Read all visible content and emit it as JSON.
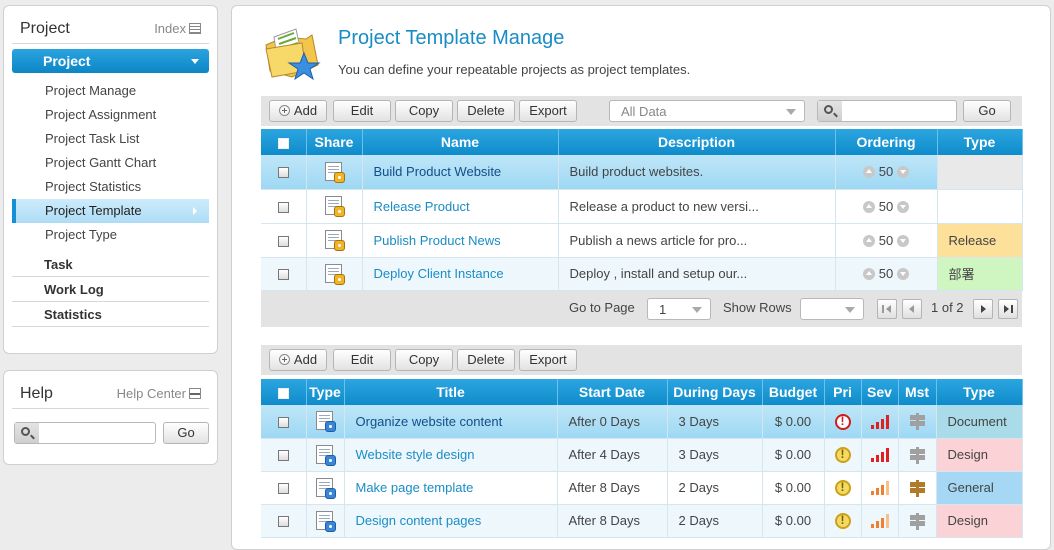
{
  "sidebar": {
    "title": "Project",
    "index_link": "Index",
    "group_label": "Project",
    "items": [
      {
        "label": "Project Manage"
      },
      {
        "label": "Project Assignment"
      },
      {
        "label": "Project Task List"
      },
      {
        "label": "Project Gantt Chart"
      },
      {
        "label": "Project Statistics"
      },
      {
        "label": "Project Template",
        "active": true
      },
      {
        "label": "Project Type"
      }
    ],
    "groups": [
      {
        "label": "Task"
      },
      {
        "label": "Work Log"
      },
      {
        "label": "Statistics"
      }
    ]
  },
  "help": {
    "title": "Help",
    "center_link": "Help Center",
    "search_value": "",
    "go_label": "Go"
  },
  "header": {
    "title": "Project Template Manage",
    "subtitle": "You can define your repeatable projects as project templates."
  },
  "toolbar1": {
    "add": "Add",
    "edit": "Edit",
    "copy": "Copy",
    "delete": "Delete",
    "export": "Export",
    "filter_value": "All Data",
    "search_value": "",
    "go": "Go"
  },
  "templates": {
    "columns": [
      "Share",
      "Name",
      "Description",
      "Ordering",
      "Type"
    ],
    "rows": [
      {
        "name": "Build Product Website",
        "description": "Build product websites.",
        "ordering": "50",
        "type": "",
        "type_color": "#e9e9e9"
      },
      {
        "name": "Release Product",
        "description": "Release a product to new versi...",
        "ordering": "50",
        "type": "",
        "type_color": "#ffffff"
      },
      {
        "name": "Publish Product News",
        "description": "Publish a news article for pro...",
        "ordering": "50",
        "type": "Release",
        "type_color": "#fde09a"
      },
      {
        "name": "Deploy Client Instance",
        "description": "Deploy , install and setup our...",
        "ordering": "50",
        "type": "部署",
        "type_color": "#cff5c0"
      }
    ]
  },
  "pager": {
    "goto_label": "Go to Page",
    "page_value": "1",
    "show_rows_label": "Show Rows",
    "rows_value": "",
    "page_info": "1 of 2"
  },
  "toolbar2": {
    "add": "Add",
    "edit": "Edit",
    "copy": "Copy",
    "delete": "Delete",
    "export": "Export"
  },
  "tasks": {
    "columns": [
      "Type",
      "Title",
      "Start Date",
      "During Days",
      "Budget",
      "Pri",
      "Sev",
      "Mst",
      "Type"
    ],
    "rows": [
      {
        "title": "Organize website content",
        "start": "After 0 Days",
        "days": "3 Days",
        "budget": "$ 0.00",
        "pri": "red",
        "sev": "high",
        "mst": "gray",
        "type": "Document",
        "type_color": "#a9dbe8"
      },
      {
        "title": "Website style design",
        "start": "After 4 Days",
        "days": "3 Days",
        "budget": "$ 0.00",
        "pri": "yellow",
        "sev": "high",
        "mst": "gray",
        "type": "Design",
        "type_color": "#fbd3d6"
      },
      {
        "title": "Make page template",
        "start": "After 8 Days",
        "days": "2 Days",
        "budget": "$ 0.00",
        "pri": "yellow",
        "sev": "med",
        "mst": "brown",
        "type": "General",
        "type_color": "#a6d8f6"
      },
      {
        "title": "Design content pages",
        "start": "After 8 Days",
        "days": "2 Days",
        "budget": "$ 0.00",
        "pri": "yellow",
        "sev": "med",
        "mst": "gray",
        "type": "Design",
        "type_color": "#fbd3d6"
      }
    ]
  },
  "colors": {
    "accent": "#1590d4",
    "title": "#1a8cc5"
  }
}
